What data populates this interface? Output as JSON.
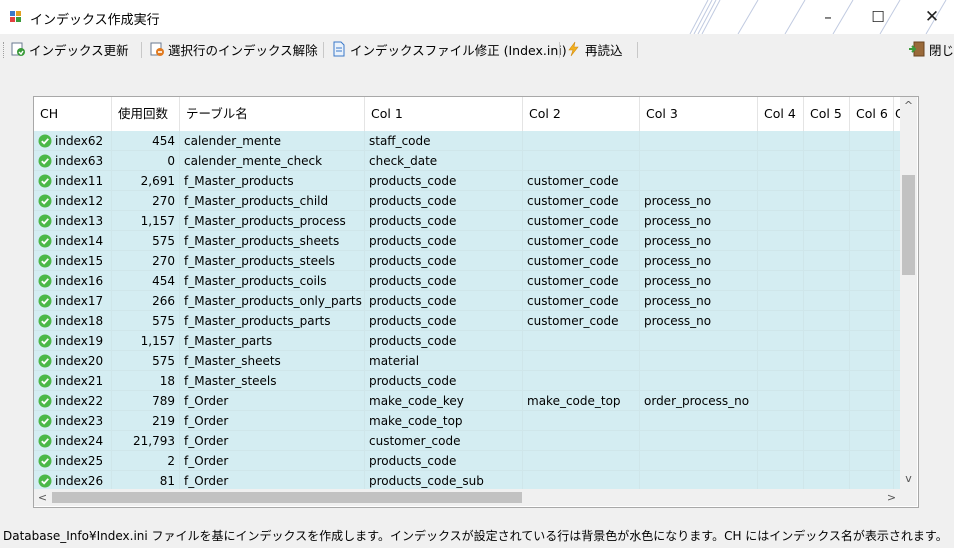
{
  "window": {
    "title": "インデックス作成実行",
    "minimize_glyph": "–",
    "maximize_glyph": "☐",
    "close_glyph": "✕"
  },
  "toolbar": {
    "update_label": "インデックス更新",
    "release_label": "選択行のインデックス解除",
    "edit_file_label": "インデックスファイル修正 (Index.ini)",
    "reload_label": "再読込",
    "close_label": "閉じる"
  },
  "grid": {
    "columns": [
      "CH",
      "使用回数",
      "テーブル名",
      "Col 1",
      "Col 2",
      "Col 3",
      "Col 4",
      "Col 5",
      "Col 6",
      "C"
    ],
    "rows": [
      {
        "ch": "index62",
        "count": "454",
        "table": "calender_mente",
        "col1": "staff_code",
        "col2": "",
        "col3": ""
      },
      {
        "ch": "index63",
        "count": "0",
        "table": "calender_mente_check",
        "col1": "check_date",
        "col2": "",
        "col3": ""
      },
      {
        "ch": "index11",
        "count": "2,691",
        "table": "f_Master_products",
        "col1": "products_code",
        "col2": "customer_code",
        "col3": ""
      },
      {
        "ch": "index12",
        "count": "270",
        "table": "f_Master_products_child",
        "col1": "products_code",
        "col2": "customer_code",
        "col3": "process_no"
      },
      {
        "ch": "index13",
        "count": "1,157",
        "table": "f_Master_products_process",
        "col1": "products_code",
        "col2": "customer_code",
        "col3": "process_no"
      },
      {
        "ch": "index14",
        "count": "575",
        "table": "f_Master_products_sheets",
        "col1": "products_code",
        "col2": "customer_code",
        "col3": "process_no"
      },
      {
        "ch": "index15",
        "count": "270",
        "table": "f_Master_products_steels",
        "col1": "products_code",
        "col2": "customer_code",
        "col3": "process_no"
      },
      {
        "ch": "index16",
        "count": "454",
        "table": "f_Master_products_coils",
        "col1": "products_code",
        "col2": "customer_code",
        "col3": "process_no"
      },
      {
        "ch": "index17",
        "count": "266",
        "table": "f_Master_products_only_parts",
        "col1": "products_code",
        "col2": "customer_code",
        "col3": "process_no"
      },
      {
        "ch": "index18",
        "count": "575",
        "table": "f_Master_products_parts",
        "col1": "products_code",
        "col2": "customer_code",
        "col3": "process_no"
      },
      {
        "ch": "index19",
        "count": "1,157",
        "table": "f_Master_parts",
        "col1": "products_code",
        "col2": "",
        "col3": ""
      },
      {
        "ch": "index20",
        "count": "575",
        "table": "f_Master_sheets",
        "col1": "material",
        "col2": "",
        "col3": ""
      },
      {
        "ch": "index21",
        "count": "18",
        "table": "f_Master_steels",
        "col1": "products_code",
        "col2": "",
        "col3": ""
      },
      {
        "ch": "index22",
        "count": "789",
        "table": "f_Order",
        "col1": "make_code_key",
        "col2": "make_code_top",
        "col3": "order_process_no"
      },
      {
        "ch": "index23",
        "count": "219",
        "table": "f_Order",
        "col1": "make_code_top",
        "col2": "",
        "col3": ""
      },
      {
        "ch": "index24",
        "count": "21,793",
        "table": "f_Order",
        "col1": "customer_code",
        "col2": "",
        "col3": ""
      },
      {
        "ch": "index25",
        "count": "2",
        "table": "f_Order",
        "col1": "products_code",
        "col2": "",
        "col3": ""
      },
      {
        "ch": "index26",
        "count": "81",
        "table": "f_Order",
        "col1": "products_code_sub",
        "col2": "",
        "col3": ""
      }
    ],
    "row_color": "#d4edf2",
    "check_color": "#4cb848"
  },
  "scroll": {
    "up_glyph": "^",
    "down_glyph": "v",
    "left_glyph": "<",
    "right_glyph": ">"
  },
  "status": {
    "text": "Database_Info¥Index.ini ファイルを基にインデックスを作成します。インデックスが設定されている行は背景色が水色になります。CH にはインデックス名が表示されます。"
  }
}
